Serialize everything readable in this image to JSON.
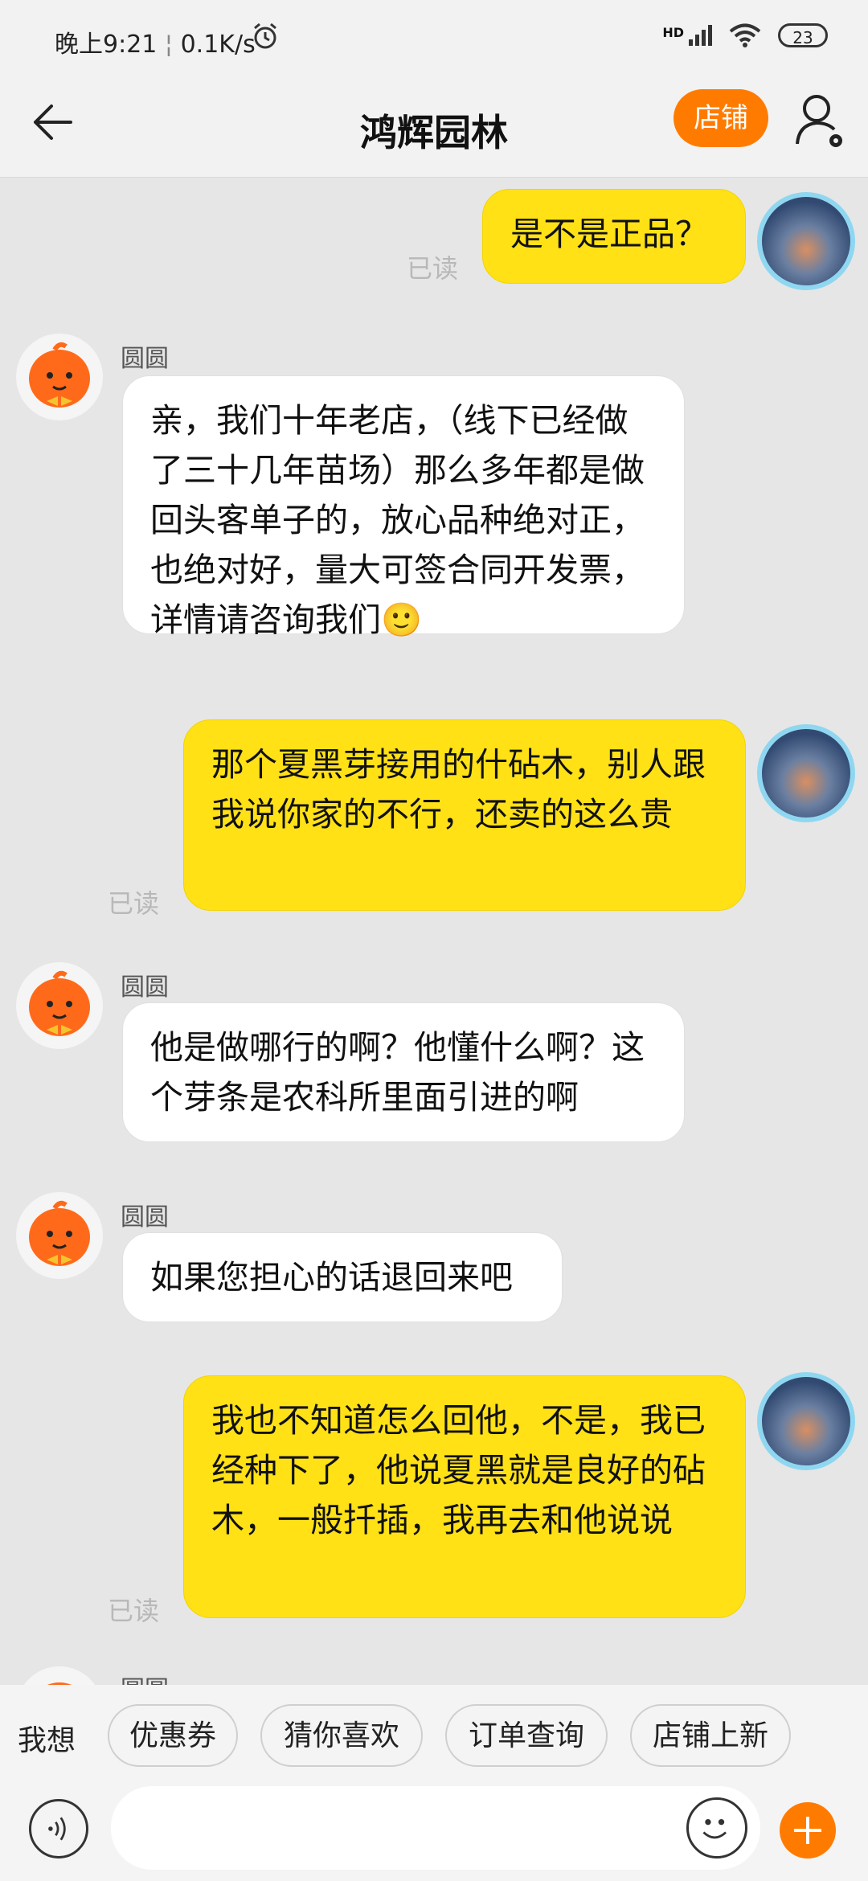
{
  "status_bar": {
    "time": "晚上9:21",
    "speed": "0.1K/s",
    "network": "HD",
    "battery": "23"
  },
  "header": {
    "title": "鸿辉园林",
    "shop_button": "店铺"
  },
  "messages": [
    {
      "from": "me",
      "text": "是不是正品？",
      "read_label": "已读"
    },
    {
      "from": "them",
      "name": "圆圆",
      "text": "亲，我们十年老店，（线下已经做了三十几年苗场）那么多年都是做回头客单子的，放心品种绝对正，也绝对好，量大可签合同开发票，详情请咨询我们🙂"
    },
    {
      "from": "me",
      "text": "那个夏黑芽接用的什砧木，别人跟我说你家的不行，还卖的这么贵",
      "read_label": "已读"
    },
    {
      "from": "them",
      "name": "圆圆",
      "text": "他是做哪行的啊？他懂什么啊？这个芽条是农科所里面引进的啊"
    },
    {
      "from": "them",
      "name": "圆圆",
      "text": "如果您担心的话退回来吧"
    },
    {
      "from": "me",
      "text": "我也不知道怎么回他，不是，我已经种下了，他说夏黑就是良好的砧木，一般扦插，我再去和他说说",
      "read_label": "已读"
    },
    {
      "from": "them",
      "name": "圆圆"
    }
  ],
  "quick_bar": {
    "label": "我想",
    "chips": [
      "优惠券",
      "猜你喜欢",
      "订单查询",
      "店铺上新"
    ]
  },
  "input": {
    "placeholder": ""
  },
  "colors": {
    "accent": "#ff7b00",
    "my_bubble": "#ffe116",
    "their_bubble": "#ffffff",
    "background": "#e6e6e6"
  },
  "icons": [
    "alarm-icon",
    "signal-icon",
    "wifi-icon",
    "back-arrow-icon",
    "user-settings-icon",
    "voice-icon",
    "emoji-icon",
    "plus-icon"
  ]
}
